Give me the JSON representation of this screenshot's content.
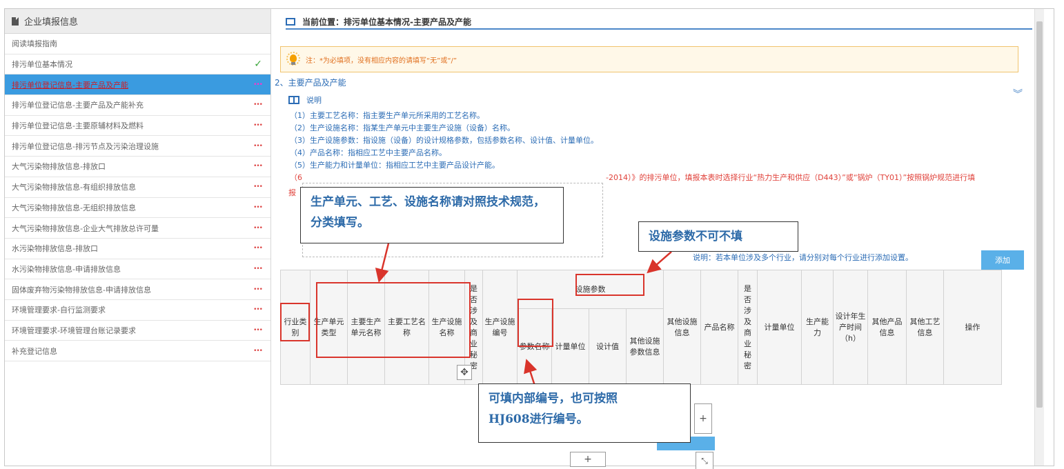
{
  "sidebar": {
    "title": "企业填报信息",
    "items": [
      {
        "label": "阅读填报指南",
        "mark": ""
      },
      {
        "label": "排污单位基本情况",
        "mark": "✓"
      },
      {
        "label": "排污单位登记信息-主要产品及产能",
        "mark": "•••",
        "active": true
      },
      {
        "label": "排污单位登记信息-主要产品及产能补充",
        "mark": "•••"
      },
      {
        "label": "排污单位登记信息-主要原辅材料及燃料",
        "mark": "•••"
      },
      {
        "label": "排污单位登记信息-排污节点及污染治理设施",
        "mark": "•••"
      },
      {
        "label": "大气污染物排放信息-排放口",
        "mark": "•••"
      },
      {
        "label": "大气污染物排放信息-有组织排放信息",
        "mark": "•••"
      },
      {
        "label": "大气污染物排放信息-无组织排放信息",
        "mark": "•••"
      },
      {
        "label": "大气污染物排放信息-企业大气排放总许可量",
        "mark": "•••"
      },
      {
        "label": "水污染物排放信息-排放口",
        "mark": "•••"
      },
      {
        "label": "水污染物排放信息-申请排放信息",
        "mark": "•••"
      },
      {
        "label": "固体废弃物污染物排放信息-申请排放信息",
        "mark": "•••"
      },
      {
        "label": "环境管理要求-自行监测要求",
        "mark": "•••"
      },
      {
        "label": "环境管理要求-环境管理台账记录要求",
        "mark": "•••"
      },
      {
        "label": "补充登记信息",
        "mark": "•••"
      }
    ]
  },
  "breadcrumb": "当前位置：排污单位基本情况-主要产品及产能",
  "notice": "注：*为必填项，没有相应内容的请填写“无”或“/”",
  "section_title": "2、主要产品及产能",
  "description": {
    "title": "说明",
    "lines": [
      "（1）主要工艺名称：指主要生产单元所采用的工艺名称。",
      "（2）生产设施名称：指某生产单元中主要生产设施（设备）名称。",
      "（3）生产设施参数：指设施（设备）的设计规格参数，包括参数名称、设计值、计量单位。",
      "（4）产品名称：指相应工艺中主要产品名称。",
      "（5）生产能力和计量单位：指相应工艺中主要产品设计产能。"
    ],
    "line6_start": "（6",
    "line6_end": "-2014）》的排污单位，填报本表时选择行业“热力生产和供应（D443）”或“锅炉（TY01）”按照锅炉规范进行填",
    "line7": "报"
  },
  "hint": "说明：若本单位涉及多个行业，请分别对每个行业进行添加设置。",
  "add_button": "添加",
  "table": {
    "industry": "行业类别",
    "unit_type": "生产单元类型",
    "main_unit": "主要生产单元名称",
    "main_process": "主要工艺名称",
    "facility_name": "生产设施名称",
    "secret1": "是否涉及商业秘密",
    "facility_no": "生产设施编号",
    "facility_params": "设施参数",
    "param_name": "参数名称",
    "param_unit": "计量单位",
    "design_value": "设计值",
    "other_params": "其他设施参数信息",
    "other_facility": "其他设施信息",
    "product_name": "产品名称",
    "secret2": "是否涉及商业秘密",
    "unit": "计量单位",
    "capacity": "生产能力",
    "design_hours": "设计年生产时间（h）",
    "other_product": "其他产品信息",
    "other_process": "其他工艺信息",
    "operation": "操作"
  },
  "callouts": {
    "naming": "生产单元、工艺、设施名称请对照技术规范，分类填写。",
    "params": "设施参数不可不填",
    "numbering_1": "可填内部编号，也可按照",
    "numbering_2": "HJ608进行编号。"
  },
  "buttons": {
    "plus": "+",
    "resize": "⤡",
    "move": "✥"
  }
}
